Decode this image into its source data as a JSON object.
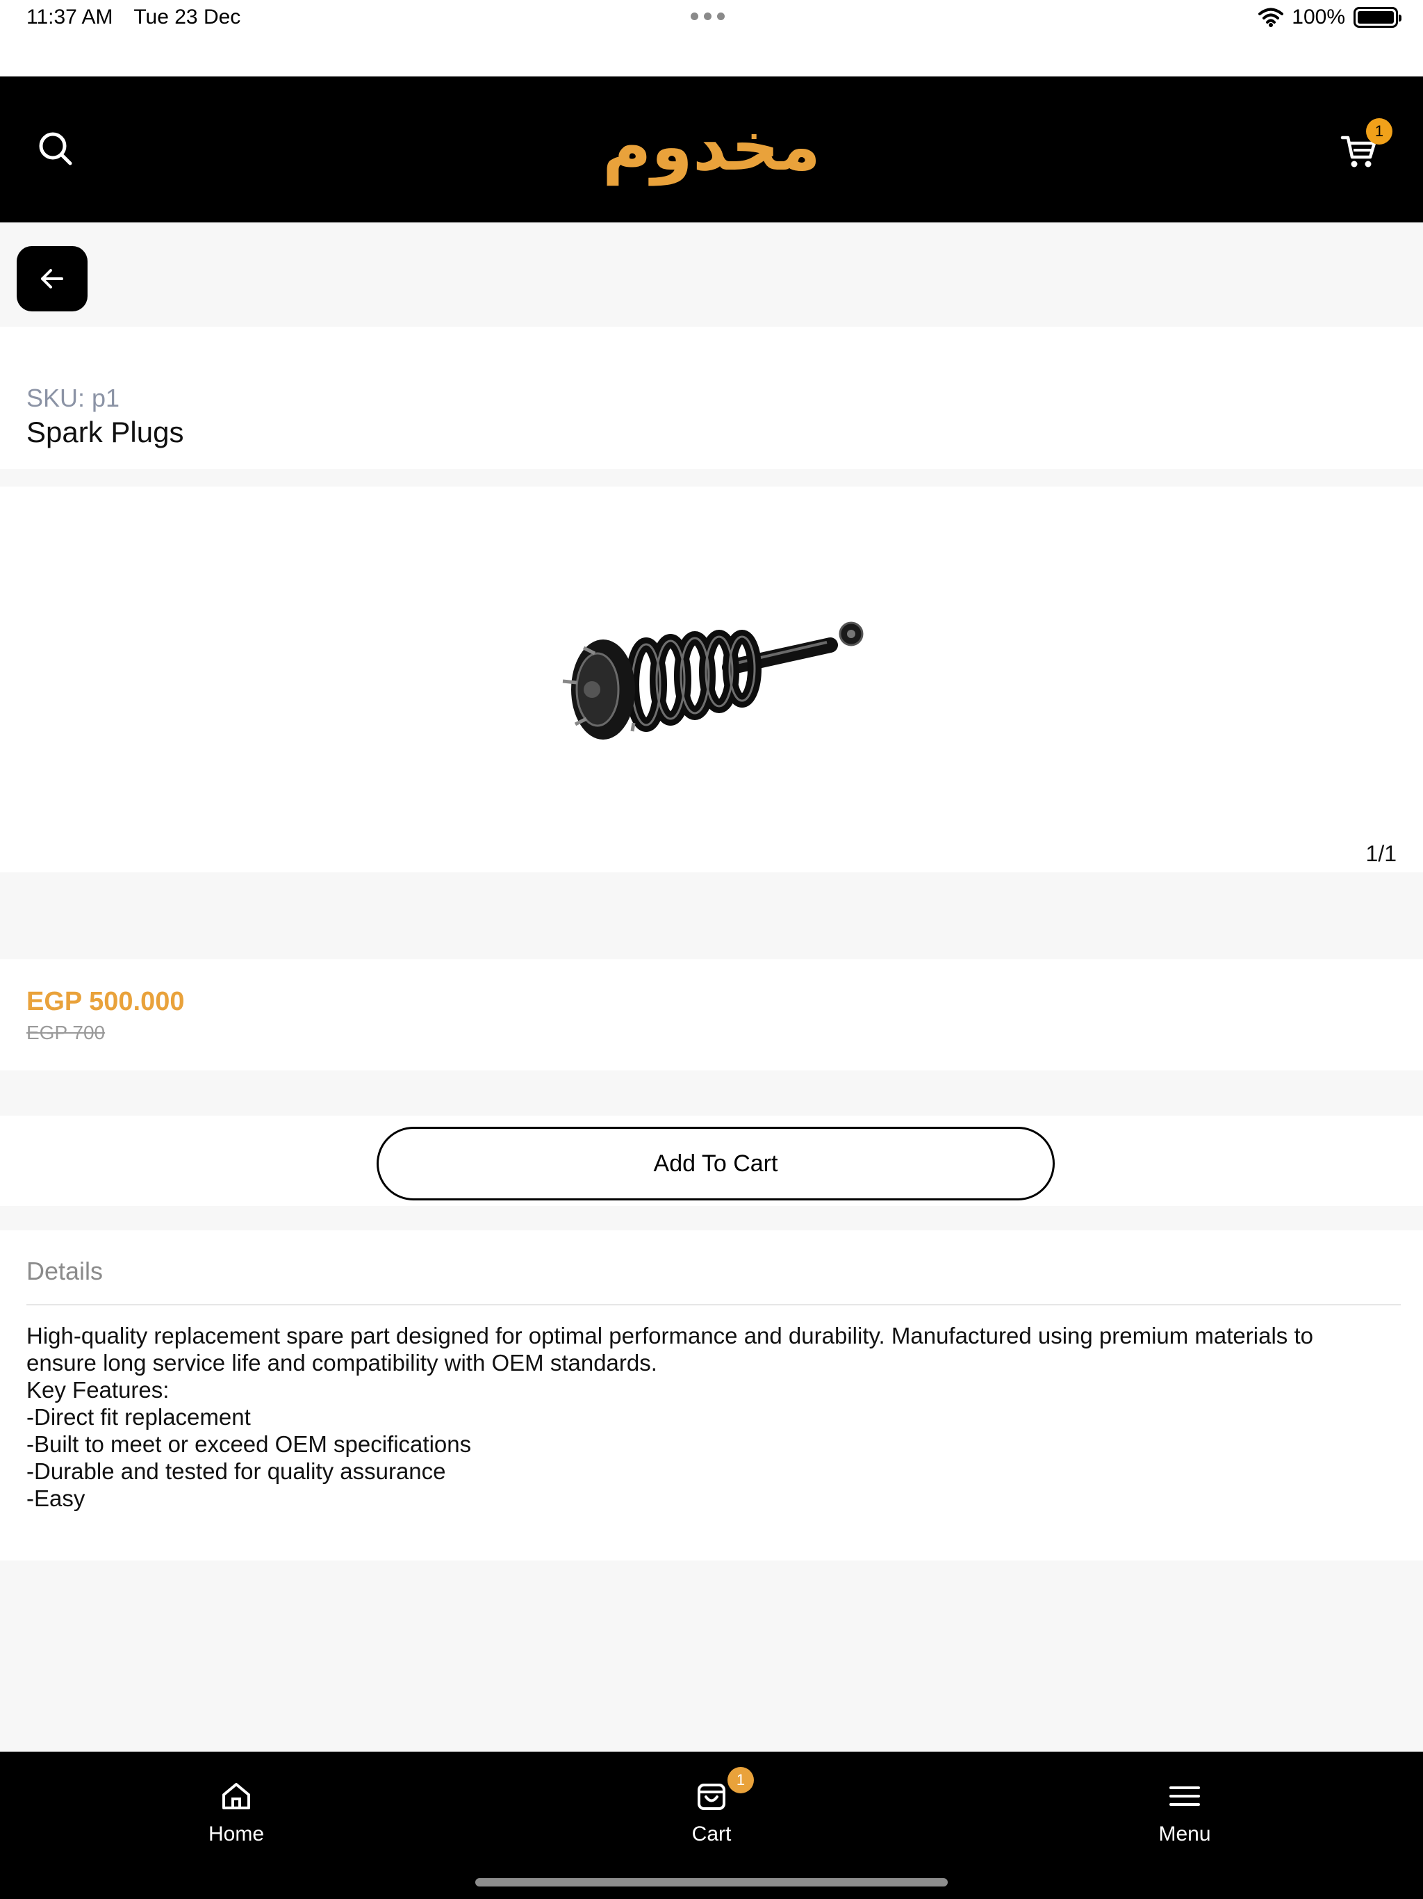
{
  "status_bar": {
    "time": "11:37 AM",
    "date": "Tue 23 Dec",
    "battery": "100%",
    "icons": [
      "wifi-icon",
      "battery-icon"
    ]
  },
  "header": {
    "brand": "مخدوم",
    "cart_count": "1",
    "icons": [
      "search-icon",
      "cart-icon"
    ],
    "brand_color": "#e9a23b"
  },
  "back": {
    "icon": "arrow-left-icon"
  },
  "product": {
    "sku": "SKU: p1",
    "title": "Spark Plugs",
    "image_counter": "1/1",
    "price": "EGP 500.000",
    "old_price": "EGP 700",
    "add_to_cart_label": "Add To Cart"
  },
  "details": {
    "title": "Details",
    "lines": [
      "High-quality replacement spare part designed for optimal performance and durability. Manufactured using premium materials to ensure long service life and compatibility with OEM standards.",
      "Key Features:",
      "-Direct fit replacement",
      "-Built to meet or exceed OEM specifications",
      "-Durable and tested for quality assurance",
      "-Easy"
    ]
  },
  "bottom_nav": {
    "items": [
      {
        "label": "Home",
        "icon": "home-icon"
      },
      {
        "label": "Cart",
        "icon": "shopping-bag-icon"
      },
      {
        "label": "Menu",
        "icon": "menu-icon"
      }
    ],
    "cart_badge": "1"
  },
  "colors": {
    "accent": "#e9a23b",
    "header_bg": "#000000",
    "muted": "#8b93a5"
  }
}
